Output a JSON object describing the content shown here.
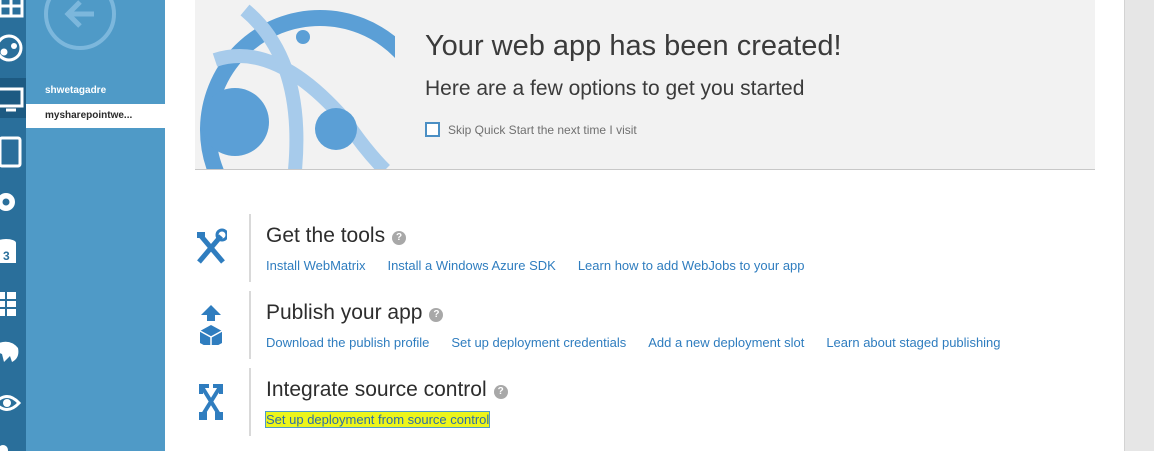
{
  "left_rail": {
    "icons": [
      "grid-icon",
      "globe-icon",
      "monitor-icon",
      "tablet-icon",
      "gear-cloud-icon",
      "database-icon",
      "table-icon",
      "elephant-icon",
      "eye-icon"
    ]
  },
  "subnav": {
    "items": [
      {
        "label": "shwetagadre",
        "active": false
      },
      {
        "label": "mysharepointwe...",
        "active": true
      }
    ]
  },
  "hero": {
    "title": "Your web app has been created!",
    "subtitle": "Here are a few options to get you started",
    "skip_label": "Skip Quick Start the next time I visit",
    "skip_checked": false
  },
  "sections": [
    {
      "title": "Get the tools",
      "icon": "tools-icon",
      "links": [
        "Install WebMatrix",
        "Install a Windows Azure SDK",
        "Learn how to add WebJobs to your app"
      ]
    },
    {
      "title": "Publish your app",
      "icon": "publish-icon",
      "links": [
        "Download the publish profile",
        "Set up deployment credentials",
        "Add a new deployment slot",
        "Learn about staged publishing"
      ]
    },
    {
      "title": "Integrate source control",
      "icon": "source-control-icon",
      "links": [
        "Set up deployment from source control"
      ]
    }
  ],
  "help_glyph": "?",
  "colors": {
    "rail": "#2a6f9b",
    "subnav": "#4f9ac7",
    "link": "#2f7dbf",
    "highlight": "#ecf51b"
  }
}
